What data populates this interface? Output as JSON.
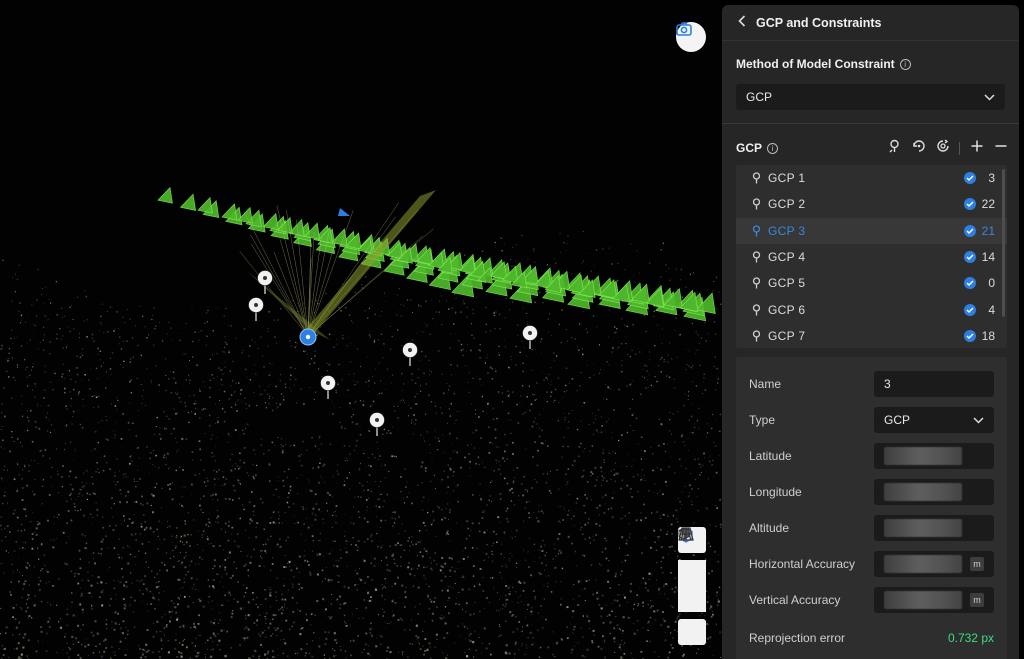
{
  "panel": {
    "title": "GCP and Constraints",
    "method_label": "Method of Model Constraint",
    "method_value": "GCP",
    "gcp_label": "GCP"
  },
  "gcp_list": [
    {
      "label": "GCP  1",
      "count": "3"
    },
    {
      "label": "GCP  2",
      "count": "22"
    },
    {
      "label": "GCP  3",
      "count": "21",
      "selected": true
    },
    {
      "label": "GCP  4",
      "count": "14"
    },
    {
      "label": "GCP  5",
      "count": "0"
    },
    {
      "label": "GCP  6",
      "count": "4"
    },
    {
      "label": "GCP  7",
      "count": "18"
    }
  ],
  "props": {
    "name_label": "Name",
    "name_value": "3",
    "type_label": "Type",
    "type_value": "GCP",
    "latitude_label": "Latitude",
    "longitude_label": "Longitude",
    "altitude_label": "Altitude",
    "h_acc_label": "Horizontal Accuracy",
    "v_acc_label": "Vertical Accuracy",
    "unit": "m",
    "reproj_label": "Reprojection error",
    "reproj_value": "0.732 px"
  },
  "colors": {
    "accent": "#2d7fe0",
    "camera_green": "#5fdc3a",
    "success": "#3ddc84",
    "panel_bg": "#262626"
  }
}
